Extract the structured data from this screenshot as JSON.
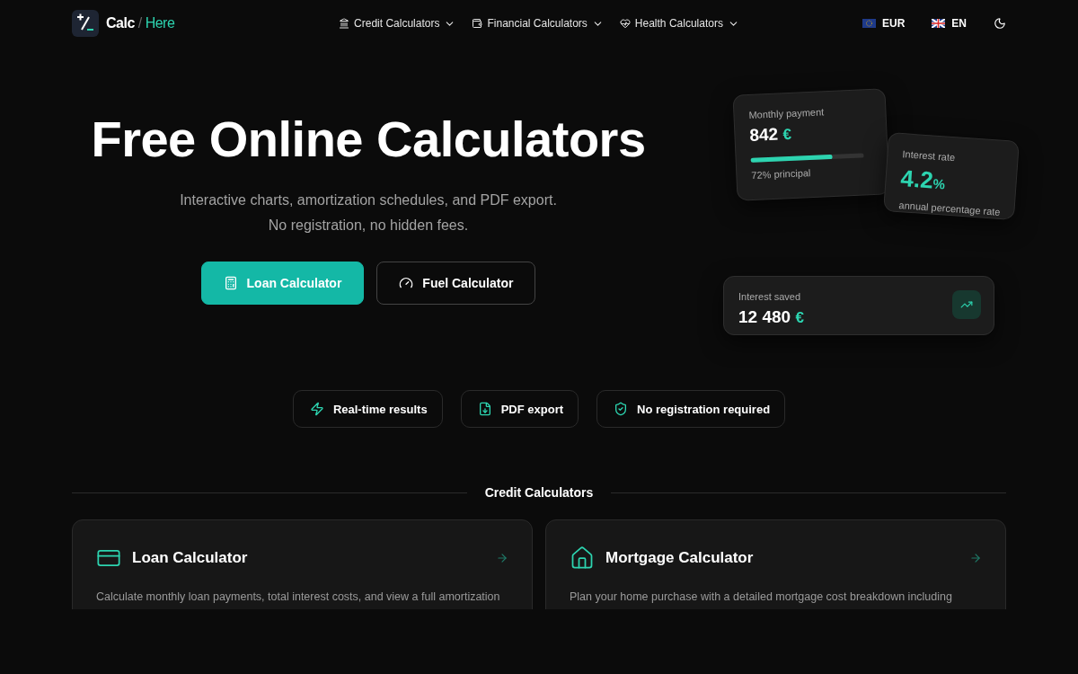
{
  "logo": {
    "main": "Calc",
    "slash": "/",
    "accent": "Here"
  },
  "nav": [
    {
      "label": "Credit Calculators"
    },
    {
      "label": "Financial Calculators"
    },
    {
      "label": "Health Calculators"
    }
  ],
  "currency": {
    "label": "EUR"
  },
  "language": {
    "label": "EN"
  },
  "hero": {
    "title": "Free Online Calculators",
    "subtitle": "Interactive charts, amortization schedules, and PDF export. No registration, no hidden fees.",
    "buttons": [
      {
        "label": "Loan Calculator",
        "kind": "primary"
      },
      {
        "label": "Fuel Calculator",
        "kind": "secondary"
      }
    ]
  },
  "stat_cards": [
    {
      "label": "Monthly payment",
      "value": "842",
      "unit": "€",
      "note": "72% principal",
      "level": 0.72
    },
    {
      "label": "Interest rate",
      "value": "4.2",
      "unit": "%",
      "note": "annual percentage rate"
    },
    {
      "label": "Interest saved",
      "value": "12 480",
      "unit": "€"
    }
  ],
  "features": [
    {
      "label": "Real-time results"
    },
    {
      "label": "PDF export"
    },
    {
      "label": "No registration required"
    }
  ],
  "section": {
    "title": "Credit Calculators",
    "cards": [
      {
        "title": "Loan Calculator",
        "description": "Calculate monthly loan payments, total interest costs, and view a full amortization"
      },
      {
        "title": "Mortgage Calculator",
        "description": "Plan your home purchase with a detailed mortgage cost breakdown including"
      }
    ]
  }
}
